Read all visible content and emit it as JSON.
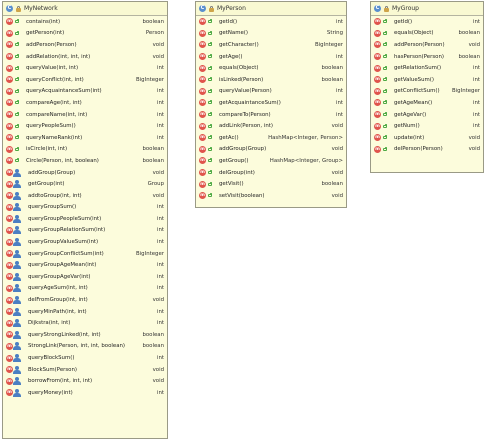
{
  "icons": {
    "class_badge": "C",
    "method_badge": "m"
  },
  "classes": [
    {
      "name": "MyNetwork",
      "methods": [
        {
          "sig": "contains(int)",
          "ret": "boolean",
          "vis": "public"
        },
        {
          "sig": "getPerson(int)",
          "ret": "Person",
          "vis": "public"
        },
        {
          "sig": "addPerson(Person)",
          "ret": "void",
          "vis": "public"
        },
        {
          "sig": "addRelation(int, int, int)",
          "ret": "void",
          "vis": "public"
        },
        {
          "sig": "queryValue(int, int)",
          "ret": "int",
          "vis": "public"
        },
        {
          "sig": "queryConflict(int, int)",
          "ret": "BigInteger",
          "vis": "public"
        },
        {
          "sig": "queryAcquaintanceSum(int)",
          "ret": "int",
          "vis": "public"
        },
        {
          "sig": "compareAge(int, int)",
          "ret": "int",
          "vis": "public"
        },
        {
          "sig": "compareName(int, int)",
          "ret": "int",
          "vis": "public"
        },
        {
          "sig": "queryPeopleSum()",
          "ret": "int",
          "vis": "public"
        },
        {
          "sig": "queryNameRank(int)",
          "ret": "int",
          "vis": "public"
        },
        {
          "sig": "isCircle(int, int)",
          "ret": "boolean",
          "vis": "public"
        },
        {
          "sig": "Circle(Person, int, boolean)",
          "ret": "boolean",
          "vis": "public"
        },
        {
          "sig": "addGroup(Group)",
          "ret": "void",
          "vis": "person"
        },
        {
          "sig": "getGroup(int)",
          "ret": "Group",
          "vis": "person"
        },
        {
          "sig": "addtoGroup(int, int)",
          "ret": "void",
          "vis": "person"
        },
        {
          "sig": "queryGroupSum()",
          "ret": "int",
          "vis": "person"
        },
        {
          "sig": "queryGroupPeopleSum(int)",
          "ret": "int",
          "vis": "person"
        },
        {
          "sig": "queryGroupRelationSum(int)",
          "ret": "int",
          "vis": "person"
        },
        {
          "sig": "queryGroupValueSum(int)",
          "ret": "int",
          "vis": "person"
        },
        {
          "sig": "queryGroupConflictSum(int)",
          "ret": "BigInteger",
          "vis": "person"
        },
        {
          "sig": "queryGroupAgeMean(int)",
          "ret": "int",
          "vis": "person"
        },
        {
          "sig": "queryGroupAgeVar(int)",
          "ret": "int",
          "vis": "person"
        },
        {
          "sig": "queryAgeSum(int, int)",
          "ret": "int",
          "vis": "person"
        },
        {
          "sig": "delFromGroup(int, int)",
          "ret": "void",
          "vis": "person"
        },
        {
          "sig": "queryMinPath(int, int)",
          "ret": "int",
          "vis": "person"
        },
        {
          "sig": "Dijkstra(int, int)",
          "ret": "int",
          "vis": "person"
        },
        {
          "sig": "queryStrongLinked(int, int)",
          "ret": "boolean",
          "vis": "person"
        },
        {
          "sig": "StrongLink(Person, int, int, boolean)",
          "ret": "boolean",
          "vis": "person"
        },
        {
          "sig": "queryBlockSum()",
          "ret": "int",
          "vis": "person"
        },
        {
          "sig": "BlockSum(Person)",
          "ret": "void",
          "vis": "person"
        },
        {
          "sig": "borrowFrom(int, int, int)",
          "ret": "void",
          "vis": "person"
        },
        {
          "sig": "queryMoney(int)",
          "ret": "int",
          "vis": "person"
        }
      ]
    },
    {
      "name": "MyPerson",
      "methods": [
        {
          "sig": "getId()",
          "ret": "int",
          "vis": "public"
        },
        {
          "sig": "getName()",
          "ret": "String",
          "vis": "public"
        },
        {
          "sig": "getCharacter()",
          "ret": "BigInteger",
          "vis": "public"
        },
        {
          "sig": "getAge()",
          "ret": "int",
          "vis": "public"
        },
        {
          "sig": "equals(Object)",
          "ret": "boolean",
          "vis": "public"
        },
        {
          "sig": "isLinked(Person)",
          "ret": "boolean",
          "vis": "public"
        },
        {
          "sig": "queryValue(Person)",
          "ret": "int",
          "vis": "public"
        },
        {
          "sig": "getAcquaintanceSum()",
          "ret": "int",
          "vis": "public"
        },
        {
          "sig": "compareTo(Person)",
          "ret": "int",
          "vis": "public"
        },
        {
          "sig": "addLink(Person, int)",
          "ret": "void",
          "vis": "public"
        },
        {
          "sig": "getAc()",
          "ret": "HashMap<Integer, Person>",
          "vis": "public"
        },
        {
          "sig": "addGroup(Group)",
          "ret": "void",
          "vis": "public"
        },
        {
          "sig": "getGroup()",
          "ret": "HashMap<Integer, Group>",
          "vis": "public"
        },
        {
          "sig": "delGroup(int)",
          "ret": "void",
          "vis": "public"
        },
        {
          "sig": "getVisit()",
          "ret": "boolean",
          "vis": "public"
        },
        {
          "sig": "setVisit(boolean)",
          "ret": "void",
          "vis": "public"
        }
      ]
    },
    {
      "name": "MyGroup",
      "methods": [
        {
          "sig": "getId()",
          "ret": "int",
          "vis": "public"
        },
        {
          "sig": "equals(Object)",
          "ret": "boolean",
          "vis": "public"
        },
        {
          "sig": "addPerson(Person)",
          "ret": "void",
          "vis": "public"
        },
        {
          "sig": "hasPerson(Person)",
          "ret": "boolean",
          "vis": "public"
        },
        {
          "sig": "getRelationSum()",
          "ret": "int",
          "vis": "public"
        },
        {
          "sig": "getValueSum()",
          "ret": "int",
          "vis": "public"
        },
        {
          "sig": "getConflictSum()",
          "ret": "BigInteger",
          "vis": "public"
        },
        {
          "sig": "getAgeMean()",
          "ret": "int",
          "vis": "public"
        },
        {
          "sig": "getAgeVar()",
          "ret": "int",
          "vis": "public"
        },
        {
          "sig": "getNum()",
          "ret": "int",
          "vis": "public"
        },
        {
          "sig": "update(int)",
          "ret": "void",
          "vis": "public"
        },
        {
          "sig": "delPerson(Person)",
          "ret": "void",
          "vis": "public"
        }
      ]
    }
  ]
}
